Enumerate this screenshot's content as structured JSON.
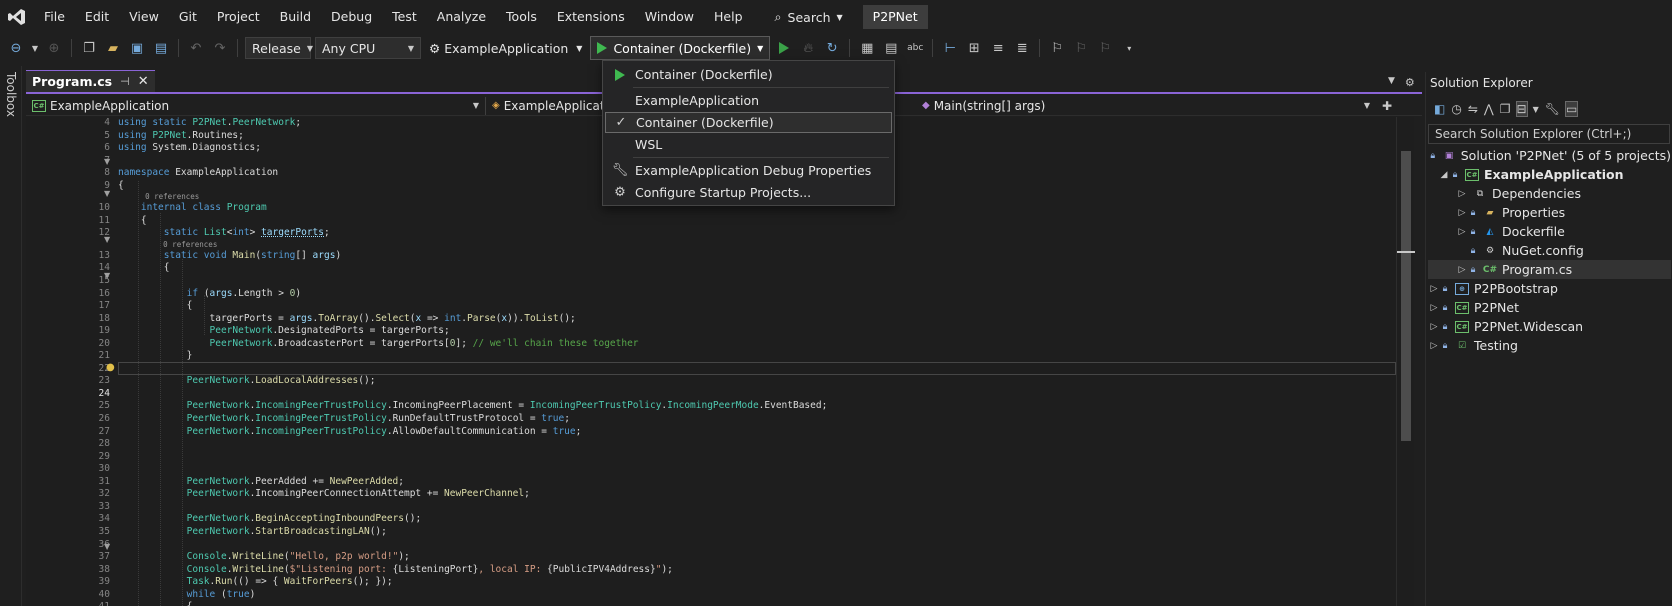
{
  "menu": {
    "items": [
      "File",
      "Edit",
      "View",
      "Git",
      "Project",
      "Build",
      "Debug",
      "Test",
      "Analyze",
      "Tools",
      "Extensions",
      "Window",
      "Help"
    ],
    "search_label": "Search",
    "solution_badge": "P2PNet"
  },
  "toolbar": {
    "configuration": "Release",
    "platform": "Any CPU",
    "startup_project": "ExampleApplication",
    "run_target": "Container (Dockerfile)"
  },
  "run_dropdown": {
    "items": [
      {
        "label": "Container (Dockerfile)",
        "icon": "play-icon"
      },
      {
        "label": "ExampleApplication",
        "icon": ""
      },
      {
        "label": "Container (Dockerfile)",
        "icon": "checkmark-icon",
        "selected": true
      },
      {
        "label": "WSL",
        "icon": ""
      },
      {
        "label": "ExampleApplication Debug Properties",
        "icon": "wrench-icon"
      },
      {
        "label": "Configure Startup Projects...",
        "icon": "gear-icon"
      }
    ]
  },
  "toolbox": {
    "label": "Toolbox"
  },
  "editor": {
    "tab_label": "Program.cs",
    "nav": {
      "project": "ExampleApplication",
      "type": "ExampleApplicatio",
      "member": "Main(string[] args)"
    },
    "line_numbers": [
      "4",
      "5",
      "6",
      "7",
      "8",
      "9",
      "",
      "10",
      "11",
      "12",
      "",
      "13",
      "14",
      "15",
      "16",
      "17",
      "18",
      "19",
      "20",
      "21",
      "22",
      "23",
      "24",
      "25",
      "26",
      "27",
      "28",
      "29",
      "30",
      "31",
      "32",
      "33",
      "34",
      "35",
      "36",
      "37",
      "38",
      "39",
      "40",
      "41"
    ],
    "current_line": "24",
    "references_label": "0 references"
  },
  "solution_explorer": {
    "title": "Solution Explorer",
    "search_placeholder": "Search Solution Explorer (Ctrl+;)",
    "solution_label": "Solution 'P2PNet' (5 of 5 projects)",
    "nodes": [
      {
        "label": "ExampleApplication",
        "bold": true
      },
      {
        "label": "Dependencies"
      },
      {
        "label": "Properties"
      },
      {
        "label": "Dockerfile"
      },
      {
        "label": "NuGet.config"
      },
      {
        "label": "Program.cs"
      },
      {
        "label": "P2PBootstrap"
      },
      {
        "label": "P2PNet"
      },
      {
        "label": "P2PNet.Widescan"
      },
      {
        "label": "Testing"
      }
    ]
  },
  "colors": {
    "accent": "#8a64d6",
    "run_green": "#3fb950",
    "keyword": "#569cd6",
    "type": "#4ec9b0"
  }
}
